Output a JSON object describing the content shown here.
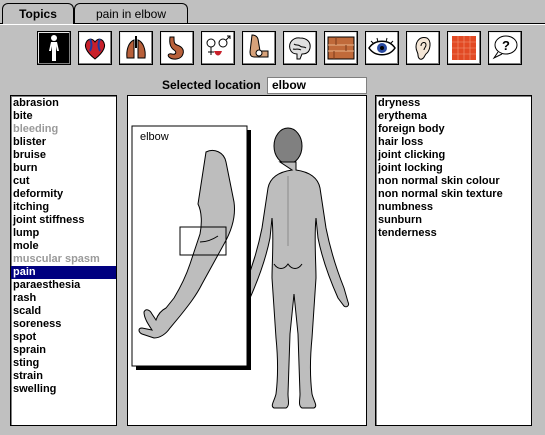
{
  "tabs": [
    {
      "label": "Topics",
      "active": true
    },
    {
      "label": "pain in elbow",
      "active": false
    }
  ],
  "toolbar": {
    "icons": [
      "full-body-icon",
      "heart-icon",
      "lungs-icon",
      "stomach-icon",
      "reproductive-icon",
      "joint-icon",
      "brain-icon",
      "skin-icon",
      "eye-icon",
      "ear-icon",
      "skin-texture-icon",
      "help-icon"
    ],
    "selected_icon": "full-body-icon"
  },
  "selected_location": {
    "label": "Selected location",
    "value": "elbow"
  },
  "symptoms": [
    {
      "label": "abrasion",
      "state": "normal"
    },
    {
      "label": "bite",
      "state": "normal"
    },
    {
      "label": "bleeding",
      "state": "disabled"
    },
    {
      "label": "blister",
      "state": "normal"
    },
    {
      "label": "bruise",
      "state": "normal"
    },
    {
      "label": "burn",
      "state": "normal"
    },
    {
      "label": "cut",
      "state": "normal"
    },
    {
      "label": "deformity",
      "state": "normal"
    },
    {
      "label": "itching",
      "state": "normal"
    },
    {
      "label": "joint stiffness",
      "state": "normal"
    },
    {
      "label": "lump",
      "state": "normal"
    },
    {
      "label": "mole",
      "state": "normal"
    },
    {
      "label": "muscular spasm",
      "state": "disabled"
    },
    {
      "label": "pain",
      "state": "selected"
    },
    {
      "label": "paraesthesia",
      "state": "normal"
    },
    {
      "label": "rash",
      "state": "normal"
    },
    {
      "label": "scald",
      "state": "normal"
    },
    {
      "label": "soreness",
      "state": "normal"
    },
    {
      "label": "spot",
      "state": "normal"
    },
    {
      "label": "sprain",
      "state": "normal"
    },
    {
      "label": "sting",
      "state": "normal"
    },
    {
      "label": "strain",
      "state": "normal"
    },
    {
      "label": "swelling",
      "state": "normal"
    }
  ],
  "related_symptoms": [
    "dryness",
    "erythema",
    "foreign body",
    "hair loss",
    "joint clicking",
    "joint locking",
    "non normal skin colour",
    "non normal skin texture",
    "numbness",
    "sunburn",
    "tenderness"
  ],
  "inset": {
    "label": "elbow"
  },
  "colors": {
    "window_bg": "#c0c0c0",
    "selection": "#000080",
    "body_fill": "#bdbdbd",
    "head_fill": "#808080"
  }
}
